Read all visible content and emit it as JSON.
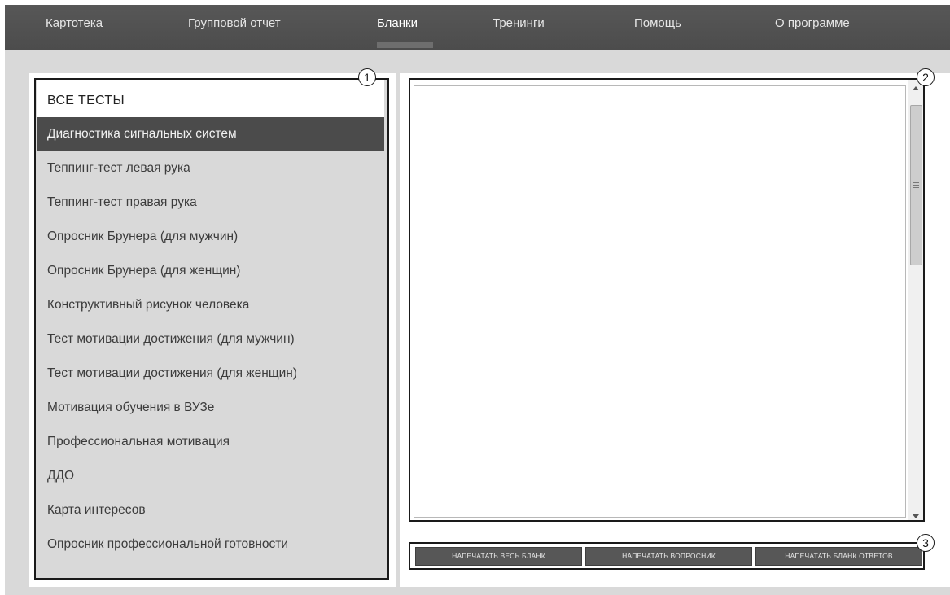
{
  "nav": {
    "items": [
      {
        "label": "Картотека"
      },
      {
        "label": "Групповой отчет"
      },
      {
        "label": "Бланки"
      },
      {
        "label": "Тренинги"
      },
      {
        "label": "Помощь"
      },
      {
        "label": "О программе"
      }
    ],
    "active_index": 2
  },
  "tests": {
    "all_label": "ВСЕ ТЕСТЫ",
    "items": [
      {
        "label": "Диагностика сигнальных систем"
      },
      {
        "label": "Теппинг-тест левая рука"
      },
      {
        "label": "Теппинг-тест правая рука"
      },
      {
        "label": "Опросник Брунера (для мужчин)"
      },
      {
        "label": "Опросник Брунера (для женщин)"
      },
      {
        "label": "Конструктивный рисунок человека"
      },
      {
        "label": "Тест мотивации достижения (для мужчин)"
      },
      {
        "label": "Тест мотивации достижения (для женщин)"
      },
      {
        "label": "Мотивация обучения в ВУЗе"
      },
      {
        "label": "Профессиональная мотивация"
      },
      {
        "label": "ДДО"
      },
      {
        "label": "Карта интересов"
      },
      {
        "label": "Опросник профессиональной готовности"
      }
    ],
    "selected_index": 0
  },
  "buttons": {
    "print_all": "НАПЕЧАТАТЬ ВЕСЬ БЛАНК",
    "print_questionnaire": "НАПЕЧАТАТЬ ВОПРОСНИК",
    "print_answers": "НАПЕЧАТАТЬ БЛАНК ОТВЕТОВ"
  },
  "callouts": [
    "1",
    "2",
    "3"
  ],
  "colors": {
    "navbar": "#4f4f4f",
    "background": "#d9d9d9",
    "selected_item": "#4b4b4b",
    "button": "#575757"
  }
}
